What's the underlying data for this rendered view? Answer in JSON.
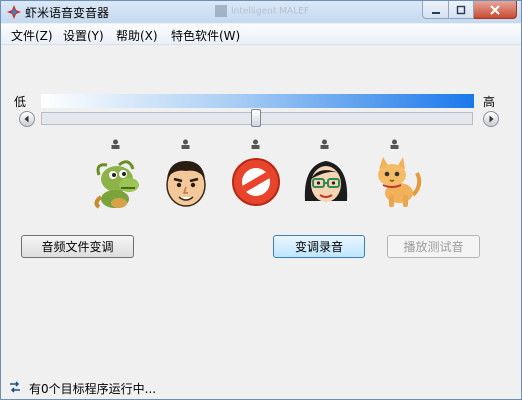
{
  "window": {
    "title": "虾米语音变音器",
    "background_title_text": "Intelligent MALEF"
  },
  "menu": [
    "文件(Z)",
    "设置(Y)",
    "帮助(X)",
    "特色软件(W)"
  ],
  "pitch_slider": {
    "low_label": "低",
    "high_label": "高",
    "value": 0.5,
    "gradient_colors": [
      "#ffffff",
      "#1a78ec"
    ]
  },
  "voice_presets": [
    {
      "icon": "dragon-icon"
    },
    {
      "icon": "man-face-icon"
    },
    {
      "icon": "no-sign-icon"
    },
    {
      "icon": "woman-glasses-icon"
    },
    {
      "icon": "cat-icon"
    }
  ],
  "buttons": {
    "audio_file_pitch": "音频文件变调",
    "pitch_record": "变调录音",
    "play_test": "播放测试音"
  },
  "status": {
    "text": "有0个目标程序运行中...",
    "icon": "swap-arrows-icon"
  }
}
